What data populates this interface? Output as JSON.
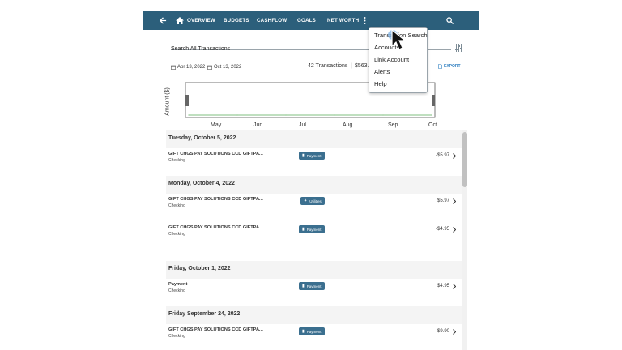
{
  "nav": {
    "items": [
      {
        "label": "OVERVIEW"
      },
      {
        "label": "BUDGETS"
      },
      {
        "label": "CASHFLOW"
      },
      {
        "label": "GOALS"
      },
      {
        "label": "NET WORTH"
      }
    ]
  },
  "icons": {
    "back": "arrow-left-icon",
    "home": "home-icon",
    "more": "more-vertical-icon",
    "search": "search-icon",
    "filter": "filter-sliders-icon",
    "calendar": "calendar-icon",
    "export": "export-icon",
    "chevron": "chevron-right-icon",
    "payment": "payment-icon",
    "utilities": "utilities-icon"
  },
  "search": {
    "placeholder": "Search All Transactions"
  },
  "filters": {
    "start_date": "Apr 13, 2022",
    "end_date": "Oct 13, 2022"
  },
  "summary": {
    "count": "42 Transactions",
    "separator": "|",
    "total": "$563."
  },
  "export_label": "EXPORT",
  "chart_data": {
    "type": "line",
    "ylabel": "Amount ($)",
    "xlabel": "",
    "x_ticks": [
      "May",
      "Jun",
      "Jul",
      "Aug",
      "Sep",
      "Oct"
    ],
    "x": [
      "May",
      "Jun",
      "Jul",
      "Aug",
      "Sep",
      "Oct"
    ],
    "series": [
      {
        "values": [
          0,
          0,
          0,
          0,
          0,
          0
        ]
      }
    ],
    "grid": false,
    "colors": {
      "line": "#7fbf7f",
      "frame": "#555555"
    }
  },
  "transactions": {
    "groups": [
      {
        "date": "Tuesday, October 5, 2022",
        "rows": [
          {
            "description": "GIFT CHGS PAY SOLUTIONS CCD GIFTPAY SOLUTIONS",
            "account": "Checking",
            "category": "Payment",
            "category_icon": "payment-icon",
            "amount": "-$5.97"
          }
        ]
      },
      {
        "date": "Monday, October 4, 2022",
        "rows": [
          {
            "description": "GIFT CHGS PAY SOLUTIONS CCD GIFTPAY SOLUTIONS",
            "account": "Checking",
            "category": "Utilities",
            "category_icon": "utilities-icon",
            "amount": "$5.97"
          },
          {
            "description": "GIFT CHGS PAY SOLUTIONS CCD GIFTPAY SOLUTIONS",
            "account": "Checking",
            "category": "Payment",
            "category_icon": "payment-icon",
            "amount": "-$4.95"
          }
        ]
      },
      {
        "date": "Friday, October 1, 2022",
        "rows": [
          {
            "description": "Payment",
            "account": "Checking",
            "category": "Payment",
            "category_icon": "payment-icon",
            "amount": "$4.95"
          }
        ]
      },
      {
        "date": "Friday September 24, 2022",
        "rows": [
          {
            "description": "GIFT CHGS PAY SOLUTIONS CCD GIFTPAY SOLUTIONS",
            "account": "Checking",
            "category": "Payment",
            "category_icon": "payment-icon",
            "amount": "-$9.90"
          }
        ]
      }
    ]
  },
  "menu": {
    "items": [
      {
        "label": "Transaction Search"
      },
      {
        "label": "Accounts"
      },
      {
        "label": "Link Account"
      },
      {
        "label": "Alerts"
      },
      {
        "label": "Help"
      }
    ]
  },
  "colors": {
    "topbar": "#2c5f7b",
    "badge": "#3b6f8f",
    "accent": "#2c7ec0"
  }
}
